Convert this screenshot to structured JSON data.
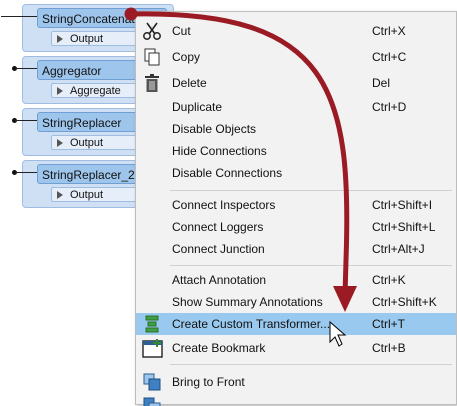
{
  "transformers": [
    {
      "name": "StringConcatenator",
      "port": "Output"
    },
    {
      "name": "Aggregator",
      "port": "Aggregate"
    },
    {
      "name": "StringReplacer",
      "port": "Output"
    },
    {
      "name": "StringReplacer_2",
      "port": "Output"
    }
  ],
  "menu": {
    "items": [
      {
        "label": "Cut",
        "shortcut": "Ctrl+X",
        "icon": "scissors-icon"
      },
      {
        "label": "Copy",
        "shortcut": "Ctrl+C",
        "icon": "copy-icon"
      },
      {
        "label": "Delete",
        "shortcut": "Del",
        "icon": "trash-icon"
      },
      {
        "label": "Duplicate",
        "shortcut": "Ctrl+D"
      },
      {
        "label": "Disable Objects",
        "shortcut": ""
      },
      {
        "label": "Hide Connections",
        "shortcut": ""
      },
      {
        "label": "Disable Connections",
        "shortcut": ""
      },
      {
        "label": "Connect Inspectors",
        "shortcut": "Ctrl+Shift+I"
      },
      {
        "label": "Connect Loggers",
        "shortcut": "Ctrl+Shift+L"
      },
      {
        "label": "Connect Junction",
        "shortcut": "Ctrl+Alt+J"
      },
      {
        "label": "Attach Annotation",
        "shortcut": "Ctrl+K"
      },
      {
        "label": "Show Summary Annotations",
        "shortcut": "Ctrl+Shift+K"
      },
      {
        "label": "Create Custom Transformer...",
        "shortcut": "Ctrl+T",
        "icon": "custom-transformer-icon",
        "highlighted": true
      },
      {
        "label": "Create Bookmark",
        "shortcut": "Ctrl+B",
        "icon": "bookmark-icon"
      },
      {
        "label": "Bring to Front",
        "shortcut": "",
        "icon": "bring-to-front-icon"
      }
    ]
  },
  "colors": {
    "highlight": "#99c9ef",
    "annotation_arrow": "#9b1b24",
    "transformer_title": "#9ec5ec",
    "input_port": "#2fae2f"
  }
}
